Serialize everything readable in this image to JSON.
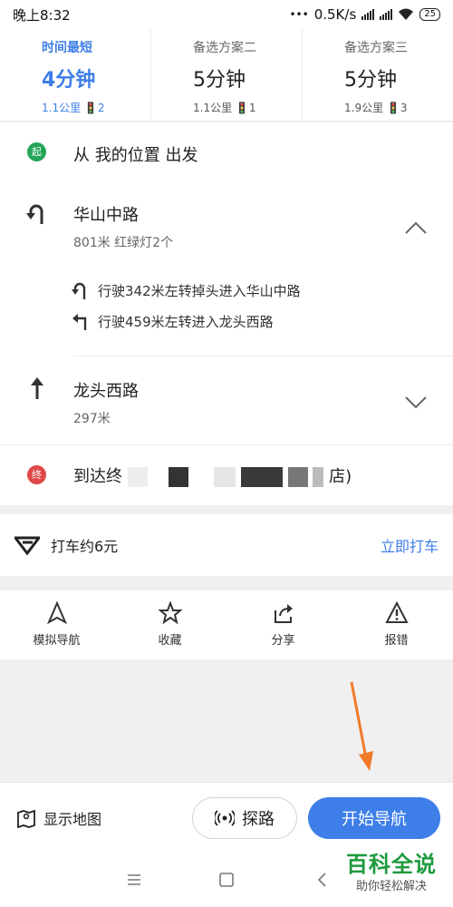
{
  "status_bar": {
    "time": "晚上8:32",
    "speed": "0.5K/s",
    "battery": "25"
  },
  "routes": [
    {
      "name": "时间最短",
      "duration": "4分钟",
      "distance": "1.1公里",
      "lights": "2",
      "active": true
    },
    {
      "name": "备选方案二",
      "duration": "5分钟",
      "distance": "1.1公里",
      "lights": "1",
      "active": false
    },
    {
      "name": "备选方案三",
      "duration": "5分钟",
      "distance": "1.9公里",
      "lights": "3",
      "active": false
    }
  ],
  "steps": {
    "start_badge": "起",
    "start_text": "从 我的位置 出发",
    "segment1": {
      "road": "华山中路",
      "detail": "801米 红绿灯2个",
      "sub_steps": [
        "行驶342米左转掉头进入华山中路",
        "行驶459米左转进入龙头西路"
      ]
    },
    "segment2": {
      "road": "龙头西路",
      "detail": "297米"
    },
    "end_badge": "终",
    "end_text_prefix": "到达终",
    "end_text_suffix": "店)"
  },
  "taxi": {
    "text": "打车约6元",
    "cta": "立即打车"
  },
  "actions": [
    {
      "label": "模拟导航",
      "icon": "navigation-arrow-icon"
    },
    {
      "label": "收藏",
      "icon": "star-icon"
    },
    {
      "label": "分享",
      "icon": "share-icon"
    },
    {
      "label": "报错",
      "icon": "warning-icon"
    }
  ],
  "bottom_bar": {
    "show_map": "显示地图",
    "explore": "探路",
    "start_nav": "开始导航"
  },
  "watermark": {
    "title": "百科全说",
    "subtitle": "助你轻松解决"
  },
  "colors": {
    "accent": "#3d7ee8",
    "start": "#23a55a",
    "end": "#e04848",
    "annotation": "#f07a2a"
  }
}
